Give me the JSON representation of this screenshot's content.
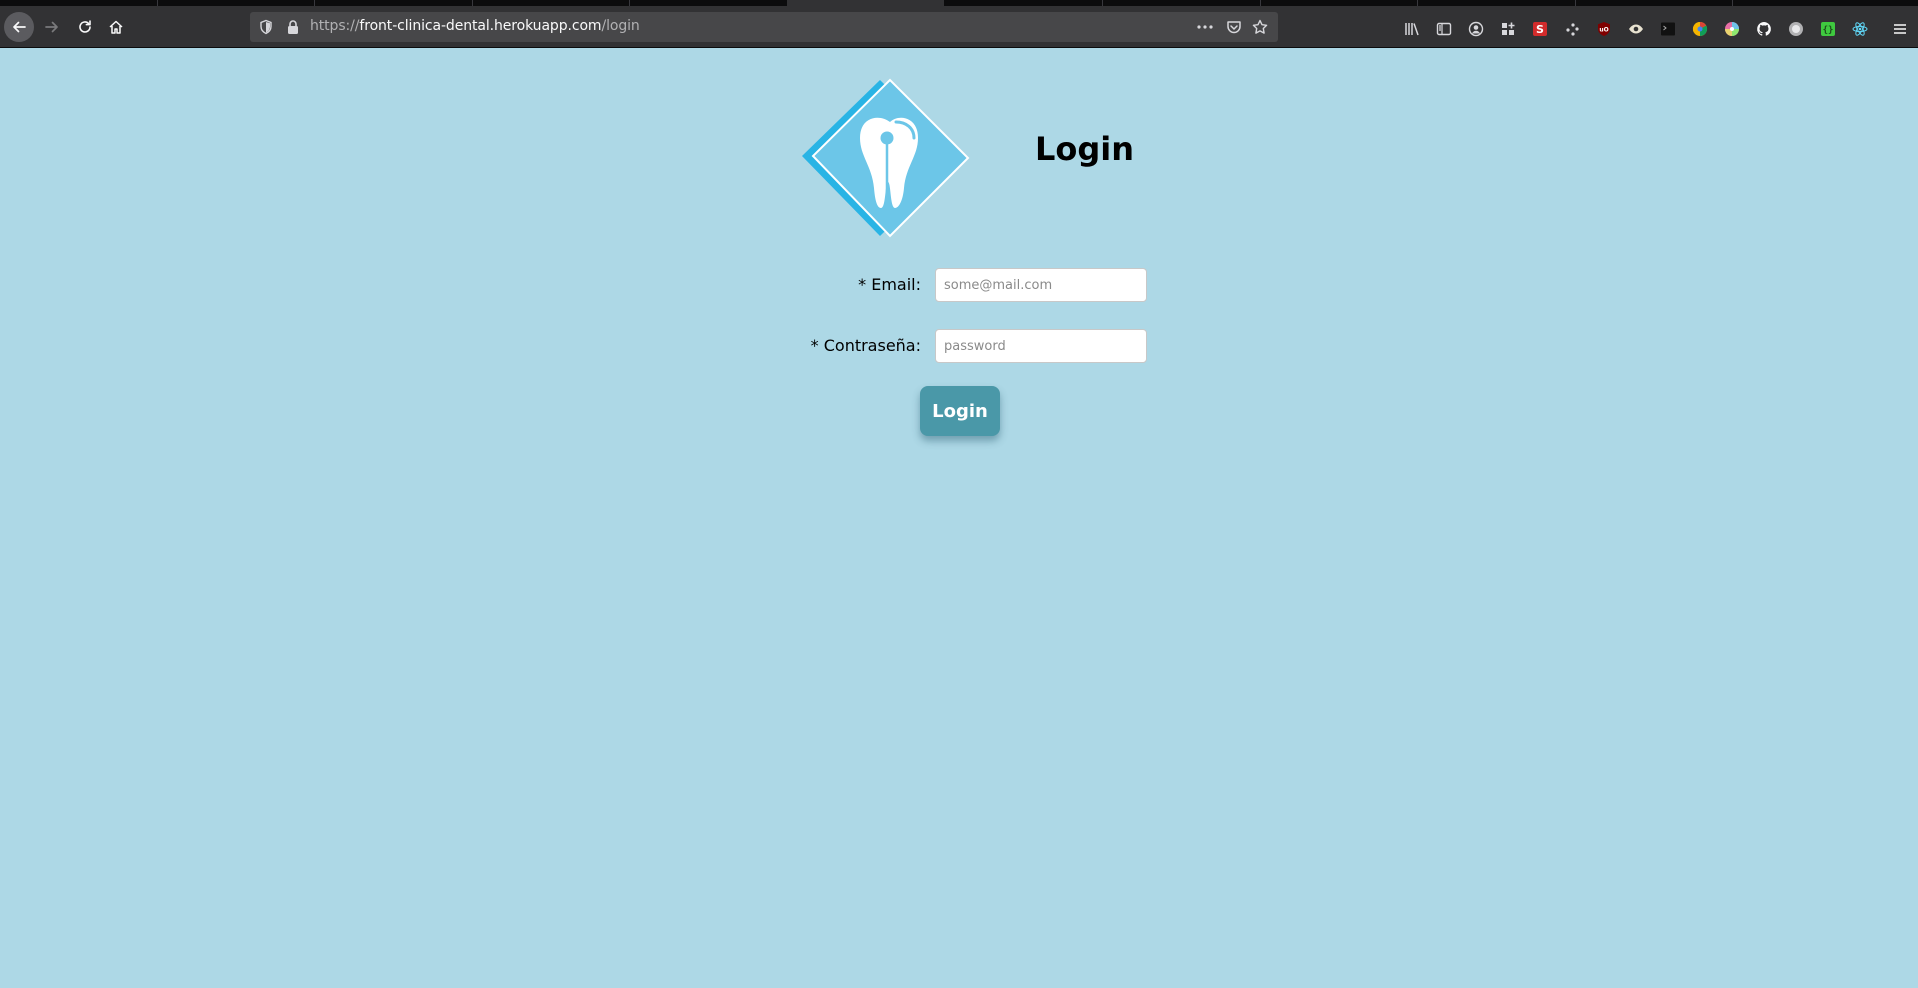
{
  "browser": {
    "url_scheme": "https://",
    "url_host": "front-clinica-dental.herokuapp.com",
    "url_path": "/login",
    "toolbar_icons": [
      "back-icon",
      "forward-icon",
      "reload-icon",
      "home-icon"
    ],
    "urlbar_icons": [
      "shield-icon",
      "lock-icon",
      "more-icon",
      "pocket-icon",
      "star-icon"
    ],
    "extension_icons": [
      "library-icon",
      "sidebar-icon",
      "account-icon",
      "extensions-grid-icon",
      "extension-s-icon",
      "dots-extension-icon",
      "ublock-icon",
      "eye-extension-icon",
      "terminal-extension-icon",
      "colorful-extension-icon",
      "palette-extension-icon",
      "github-icon",
      "circle-extension-icon",
      "json-extension-icon",
      "react-icon",
      "menu-icon"
    ]
  },
  "page": {
    "title": "Login",
    "logo_icon": "tooth-logo-icon",
    "form": {
      "email_label": "* Email:",
      "email_placeholder": "some@mail.com",
      "email_value": "",
      "password_label": "* Contraseña:",
      "password_placeholder": "password",
      "password_value": "",
      "submit_label": "Login"
    }
  },
  "colors": {
    "page_background": "#add8e6",
    "logo_blue": "#6cc6e8",
    "logo_dark_blue": "#29b4e5",
    "button_background": "#4a98a8"
  }
}
